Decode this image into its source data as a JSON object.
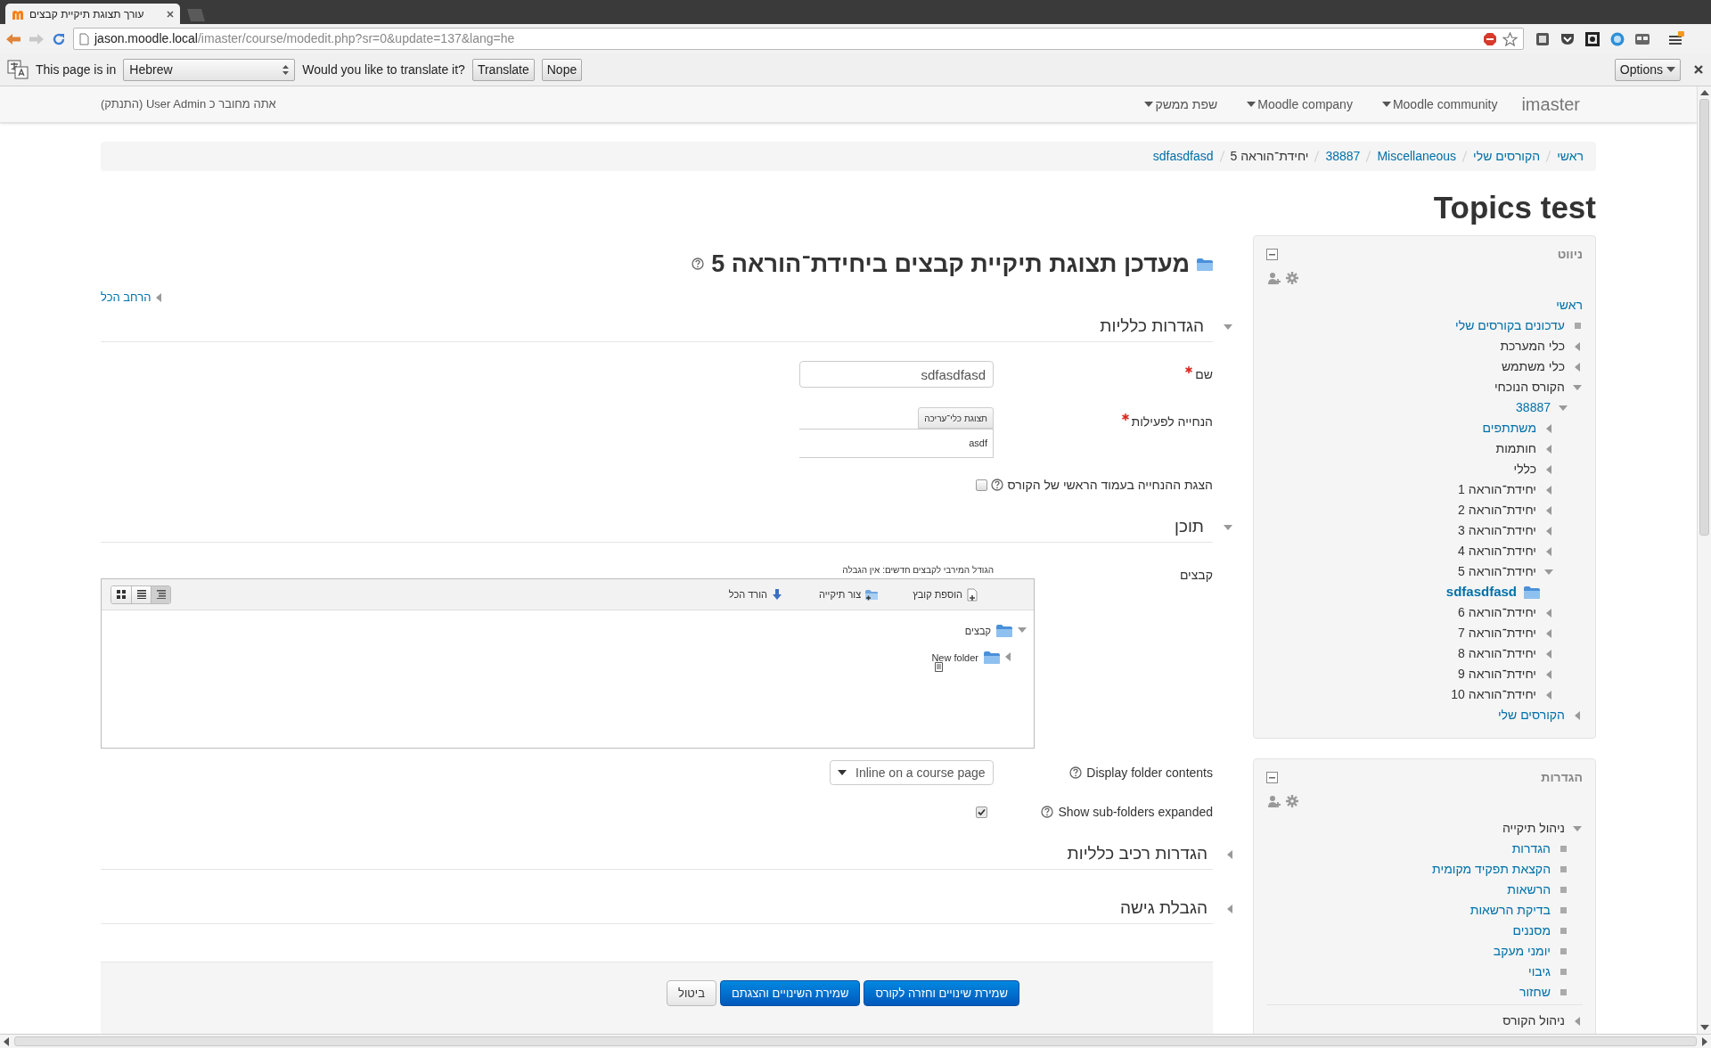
{
  "browser": {
    "tab_title": "עורך תצוגת תיקיית קבצים",
    "url_host": "jason.moodle.local",
    "url_path": "/imaster/course/modedit.php?sr=0&update=137&lang=he"
  },
  "translate_bar": {
    "prefix": "This page is in",
    "language": "Hebrew",
    "question": "Would you like to translate it?",
    "translate_button": "Translate",
    "dismiss_button": "Nope",
    "options": "Options"
  },
  "navbar": {
    "brand": "imaster",
    "menus": [
      "Moodle community",
      "Moodle company",
      "שפת ממשק"
    ],
    "login_info": "אתה מחובר כ User Admin (התנתק)"
  },
  "breadcrumb": [
    {
      "label": "ראשי",
      "link": true
    },
    {
      "label": "הקורסים שלי",
      "link": true
    },
    {
      "label": "Miscellaneous",
      "link": true
    },
    {
      "label": "38887",
      "link": true
    },
    {
      "label": "יחידת־הוראה 5",
      "link": false
    },
    {
      "label": "sdfasdfasd",
      "link": true
    }
  ],
  "page_title": "Topics test",
  "heading": "מעדכן תצוגת תיקיית קבצים ביחידת־הוראה 5",
  "expand_all": "הרחב הכל",
  "sections": [
    {
      "title": "הגדרות כלליות",
      "expanded": true,
      "fields": [
        {
          "kind": "text",
          "label": "שם",
          "required": true,
          "value": "sdfasdfasd"
        },
        {
          "kind": "editor",
          "label": "הנחייה לפעילות",
          "required": true,
          "toolbar_button": "תצוגת כלי־עריכה",
          "value": "asdf"
        },
        {
          "kind": "checkbox",
          "label": "הצגת ההנחייה בעמוד הראשי של הקורס",
          "help": true,
          "checked": false
        }
      ]
    },
    {
      "title": "תוכן",
      "expanded": true,
      "fields": [
        {
          "kind": "filemanager",
          "label": "קבצים",
          "note": "הגודל המירבי לקבצים חדשים: אין הגבלה",
          "actions": [
            {
              "label": "הוספת קובץ",
              "kind": "add-file"
            },
            {
              "label": "צור תיקייה",
              "kind": "new-folder"
            },
            {
              "label": "הורד הכל",
              "kind": "download"
            }
          ],
          "views": [
            {
              "kind": "icons",
              "selected": false
            },
            {
              "kind": "list",
              "selected": false
            },
            {
              "kind": "tree",
              "selected": true
            }
          ],
          "tree": [
            {
              "name": "קבצים",
              "expanded": true,
              "children": [
                {
                  "name": "New folder",
                  "expanded": false
                }
              ]
            }
          ]
        },
        {
          "kind": "select",
          "label": "Display folder contents",
          "help": true,
          "value": "Inline on a course page"
        },
        {
          "kind": "checkbox",
          "label": "Show sub-folders expanded",
          "help": true,
          "checked": true
        }
      ]
    },
    {
      "title": "הגדרות רכיב כלליות",
      "expanded": false
    },
    {
      "title": "הגבלת גישה",
      "expanded": false
    }
  ],
  "buttons": [
    {
      "label": "שמירת שינויים וחזרה לקורס",
      "kind": "primary"
    },
    {
      "label": "שמירת השינויים והצגתם",
      "kind": "primary"
    },
    {
      "label": "ביטול",
      "kind": "default"
    }
  ],
  "blocks": [
    {
      "kind": "navigation",
      "title": "ניווט",
      "items": [
        {
          "label": "ראשי",
          "kind": "root",
          "link": true
        },
        {
          "label": "עדכונים בקורסים שלי",
          "kind": "leaf",
          "link": true
        },
        {
          "label": "כלי המערכת",
          "kind": "branch",
          "link": false,
          "expanded": false
        },
        {
          "label": "כלי משתמש",
          "kind": "branch",
          "link": false,
          "expanded": false
        },
        {
          "label": "הקורס הנוכחי",
          "kind": "branch",
          "link": false,
          "expanded": true,
          "children": [
            {
              "label": "38887",
              "kind": "branch",
              "link": true,
              "expanded": true,
              "children": [
                {
                  "label": "משתתפים",
                  "kind": "branch",
                  "link": true,
                  "expanded": false
                },
                {
                  "label": "חותמות",
                  "kind": "branch",
                  "link": false,
                  "expanded": false
                },
                {
                  "label": "כללי",
                  "kind": "branch",
                  "link": false,
                  "expanded": false
                },
                {
                  "label": "יחידת־הוראה 1",
                  "kind": "branch",
                  "link": false,
                  "expanded": false
                },
                {
                  "label": "יחידת־הוראה 2",
                  "kind": "branch",
                  "link": false,
                  "expanded": false
                },
                {
                  "label": "יחידת־הוראה 3",
                  "kind": "branch",
                  "link": false,
                  "expanded": false
                },
                {
                  "label": "יחידת־הוראה 4",
                  "kind": "branch",
                  "link": false,
                  "expanded": false
                },
                {
                  "label": "יחידת־הוראה 5",
                  "kind": "branch",
                  "link": false,
                  "expanded": true,
                  "children": [
                    {
                      "label": "sdfasdfasd",
                      "kind": "activity",
                      "link": true
                    }
                  ]
                },
                {
                  "label": "יחידת־הוראה 6",
                  "kind": "branch",
                  "link": false,
                  "expanded": false
                },
                {
                  "label": "יחידת־הוראה 7",
                  "kind": "branch",
                  "link": false,
                  "expanded": false
                },
                {
                  "label": "יחידת־הוראה 8",
                  "kind": "branch",
                  "link": false,
                  "expanded": false
                },
                {
                  "label": "יחידת־הוראה 9",
                  "kind": "branch",
                  "link": false,
                  "expanded": false
                },
                {
                  "label": "יחידת־הוראה 10",
                  "kind": "branch",
                  "link": false,
                  "expanded": false
                }
              ]
            }
          ]
        },
        {
          "label": "הקורסים שלי",
          "kind": "branch",
          "link": true,
          "expanded": false
        }
      ]
    },
    {
      "kind": "settings",
      "title": "הגדרות",
      "items": [
        {
          "label": "ניהול תיקייה",
          "kind": "branch",
          "link": false,
          "expanded": true,
          "children": [
            {
              "label": "הגדרות",
              "kind": "leaf",
              "link": true
            },
            {
              "label": "הקצאת תפקיד מקומית",
              "kind": "leaf",
              "link": true
            },
            {
              "label": "הרשאות",
              "kind": "leaf",
              "link": true
            },
            {
              "label": "בדיקת הרשאות",
              "kind": "leaf",
              "link": true
            },
            {
              "label": "מסננים",
              "kind": "leaf",
              "link": true
            },
            {
              "label": "יומני מעקב",
              "kind": "leaf",
              "link": true
            },
            {
              "label": "גיבוי",
              "kind": "leaf",
              "link": true
            },
            {
              "label": "שחזור",
              "kind": "leaf",
              "link": true
            }
          ]
        },
        {
          "label": "ניהול הקורס",
          "kind": "branch",
          "link": false,
          "expanded": false
        }
      ]
    }
  ]
}
